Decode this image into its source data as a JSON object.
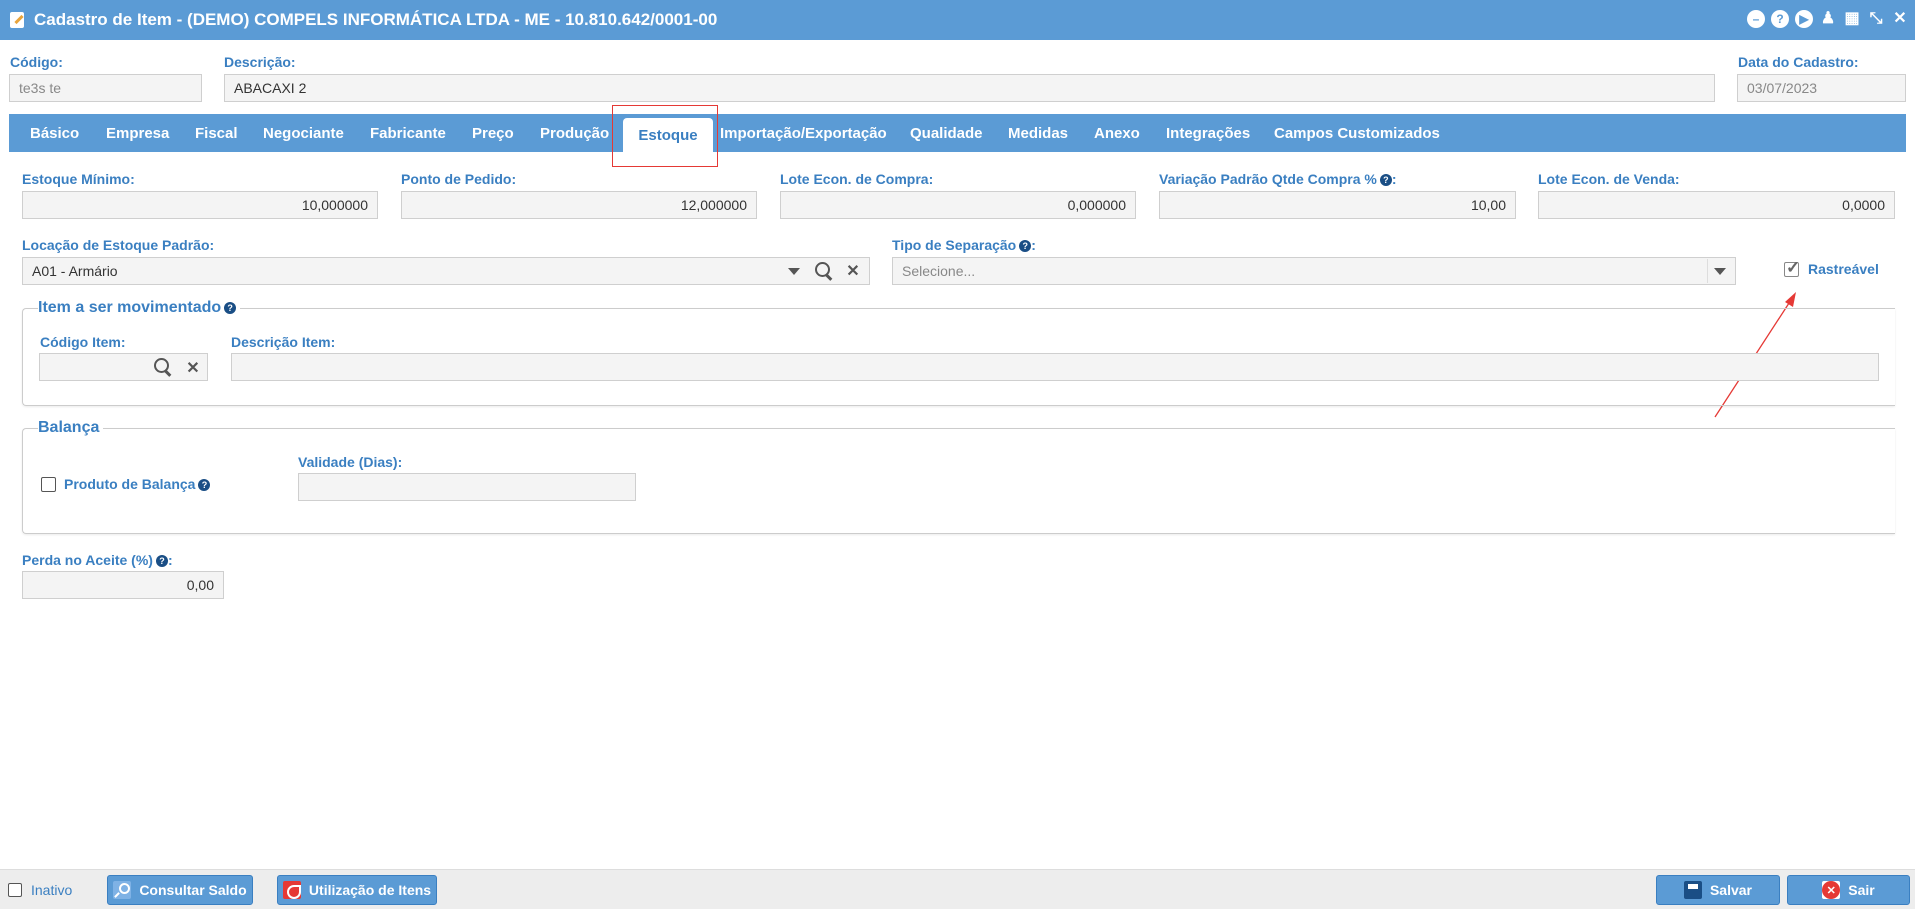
{
  "window": {
    "title": "Cadastro de Item - (DEMO) COMPELS INFORMÁTICA LTDA - ME - 10.810.642/0001-00"
  },
  "header": {
    "codigo_label": "Código:",
    "codigo_value": "te3s te",
    "descricao_label": "Descrição:",
    "descricao_value": "ABACAXI 2",
    "data_label": "Data do Cadastro:",
    "data_value": "03/07/2023"
  },
  "tabs": [
    {
      "label": "Básico"
    },
    {
      "label": "Empresa"
    },
    {
      "label": "Fiscal"
    },
    {
      "label": "Negociante"
    },
    {
      "label": "Fabricante"
    },
    {
      "label": "Preço"
    },
    {
      "label": "Produção"
    },
    {
      "label": "Estoque",
      "active": true
    },
    {
      "label": "Importação/Exportação"
    },
    {
      "label": "Qualidade"
    },
    {
      "label": "Medidas"
    },
    {
      "label": "Anexo"
    },
    {
      "label": "Integrações"
    },
    {
      "label": "Campos Customizados"
    }
  ],
  "estoque": {
    "estoque_minimo_label": "Estoque Mínimo:",
    "estoque_minimo_value": "10,000000",
    "ponto_pedido_label": "Ponto de Pedido:",
    "ponto_pedido_value": "12,000000",
    "lote_compra_label": "Lote Econ. de Compra:",
    "lote_compra_value": "0,000000",
    "variacao_label": "Variação Padrão Qtde Compra %",
    "variacao_suffix": ":",
    "variacao_value": "10,00",
    "lote_venda_label": "Lote Econ. de Venda:",
    "lote_venda_value": "0,0000",
    "locacao_label": "Locação de Estoque Padrão:",
    "locacao_value": "A01 - Armário",
    "tipo_separacao_label": "Tipo de Separação",
    "tipo_separacao_suffix": ":",
    "tipo_separacao_placeholder": "Selecione...",
    "rastreavel_label": "Rastreável",
    "rastreavel_checked": true
  },
  "item_movimentado": {
    "legend": "Item a ser movimentado",
    "codigo_label": "Código Item:",
    "codigo_value": "",
    "descricao_label": "Descrição Item:",
    "descricao_value": ""
  },
  "balanca": {
    "legend": "Balança",
    "produto_label": "Produto de Balança",
    "produto_checked": false,
    "validade_label": "Validade (Dias):",
    "validade_value": ""
  },
  "perda": {
    "label": "Perda no Aceite (%)",
    "suffix": ":",
    "value": "0,00"
  },
  "footer": {
    "inativo_label": "Inativo",
    "consultar_label": "Consultar Saldo",
    "utilizacao_label": "Utilização de Itens",
    "salvar_label": "Salvar",
    "sair_label": "Sair"
  },
  "colors": {
    "accent": "#5b9bd5",
    "label": "#3a7fc1",
    "highlight": "#e53935"
  },
  "help_glyph": "?",
  "window_icons": [
    "minimize-icon",
    "help-icon",
    "play-icon",
    "bell-icon",
    "calendar-icon",
    "compress-icon",
    "close-icon"
  ]
}
